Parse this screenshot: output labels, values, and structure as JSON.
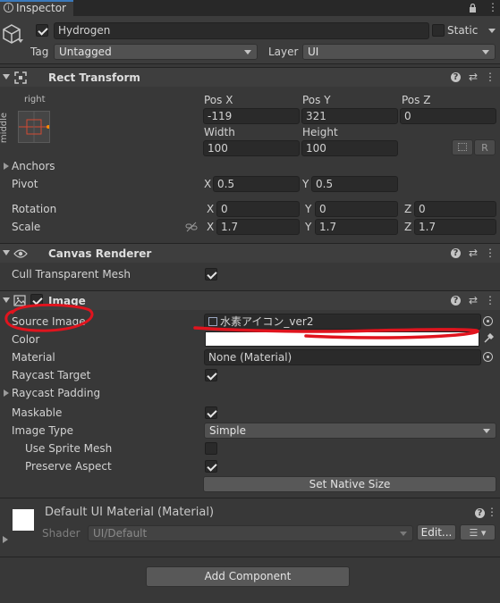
{
  "tab": {
    "title": "Inspector"
  },
  "gameobject": {
    "active": true,
    "name": "Hydrogen",
    "static_label": "Static",
    "static_checked": false,
    "tag_label": "Tag",
    "tag_value": "Untagged",
    "layer_label": "Layer",
    "layer_value": "UI"
  },
  "rect_transform": {
    "title": "Rect Transform",
    "anchor_h": "right",
    "anchor_v": "middle",
    "pos_x_label": "Pos X",
    "pos_x": "-119",
    "pos_y_label": "Pos Y",
    "pos_y": "321",
    "pos_z_label": "Pos Z",
    "pos_z": "0",
    "width_label": "Width",
    "width": "100",
    "height_label": "Height",
    "height": "100",
    "r_button": "R",
    "anchors_label": "Anchors",
    "pivot_label": "Pivot",
    "pivot_x": "0.5",
    "pivot_y": "0.5",
    "rotation_label": "Rotation",
    "rot_x": "0",
    "rot_y": "0",
    "rot_z": "0",
    "scale_label": "Scale",
    "scale_x": "1.7",
    "scale_y": "1.7",
    "scale_z": "1.7",
    "x": "X",
    "y": "Y",
    "z": "Z"
  },
  "canvas_renderer": {
    "title": "Canvas Renderer",
    "cull_label": "Cull Transparent Mesh",
    "cull_checked": true
  },
  "image": {
    "title": "Image",
    "enabled": true,
    "source_image_label": "Source Image",
    "source_image_value": "水素アイコン_ver2",
    "color_label": "Color",
    "color_value": "#ffffff",
    "material_label": "Material",
    "material_value": "None (Material)",
    "raycast_target_label": "Raycast Target",
    "raycast_target_checked": true,
    "raycast_padding_label": "Raycast Padding",
    "maskable_label": "Maskable",
    "maskable_checked": true,
    "image_type_label": "Image Type",
    "image_type_value": "Simple",
    "use_sprite_mesh_label": "Use Sprite Mesh",
    "use_sprite_mesh_checked": false,
    "preserve_aspect_label": "Preserve Aspect",
    "preserve_aspect_checked": true,
    "set_native_size": "Set Native Size"
  },
  "material_panel": {
    "title": "Default UI Material (Material)",
    "shader_label": "Shader",
    "shader_value": "UI/Default",
    "edit_button": "Edit..."
  },
  "add_component": "Add Component",
  "annotation_color": "#e0141e"
}
